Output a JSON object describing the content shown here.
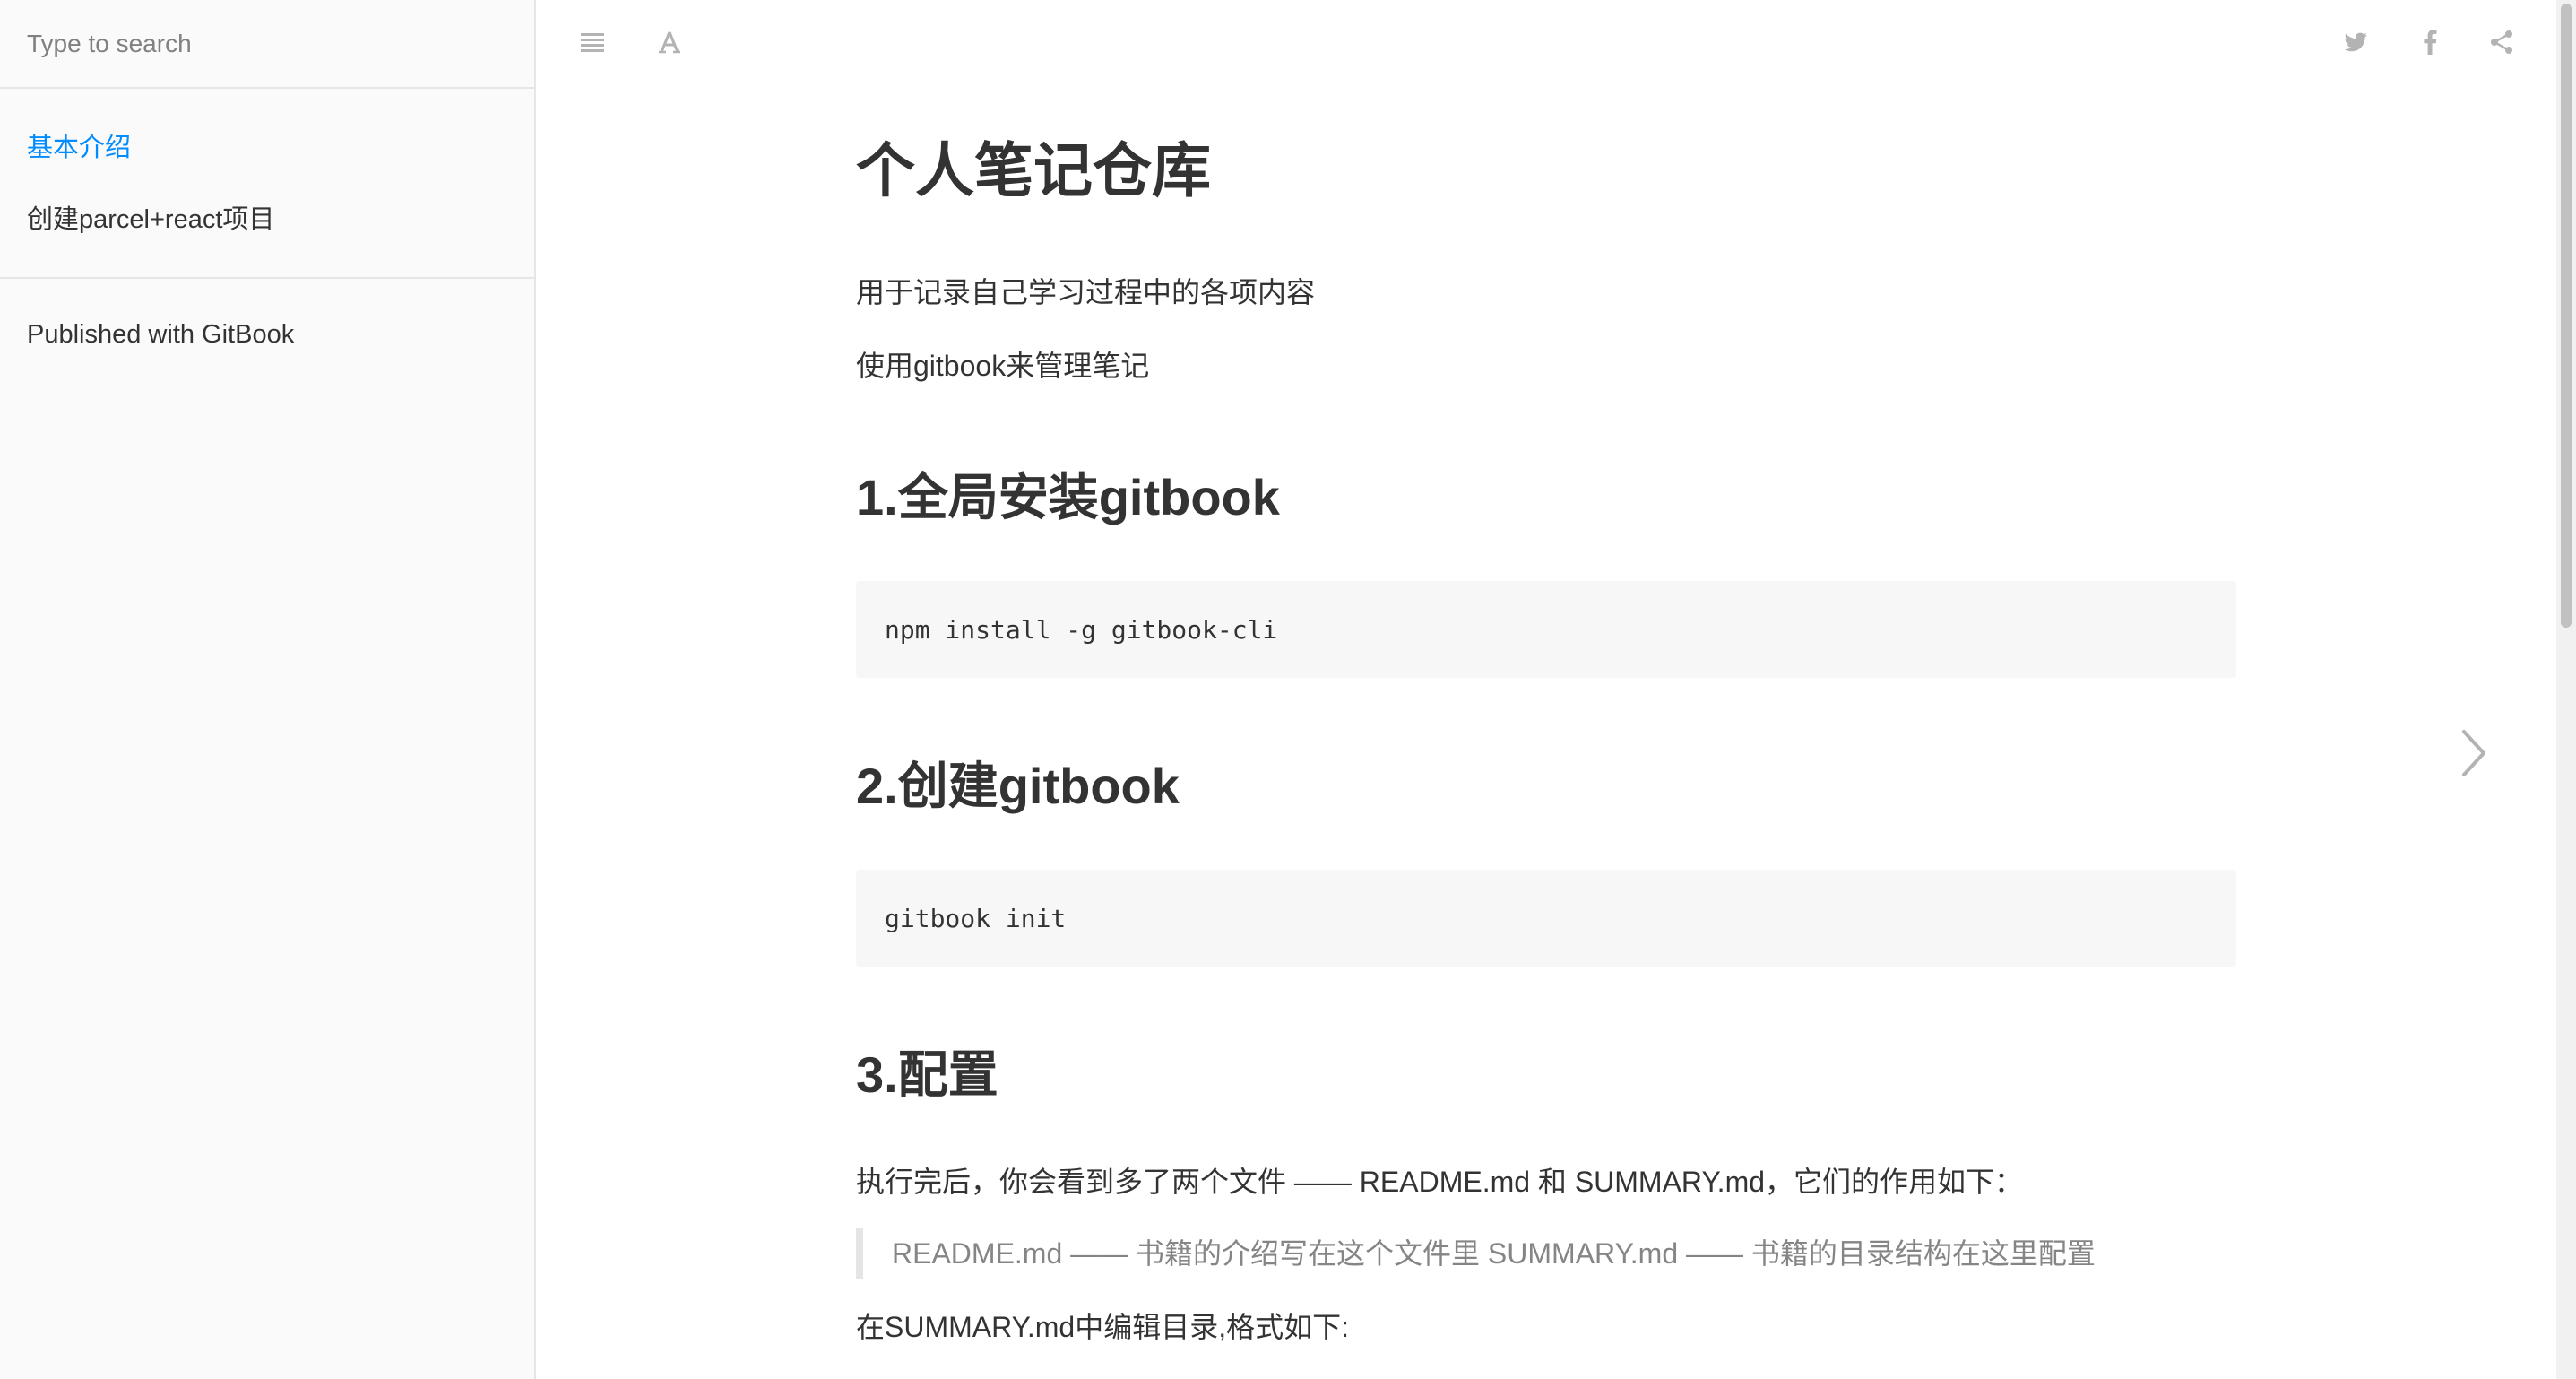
{
  "sidebar": {
    "search_placeholder": "Type to search",
    "chapters": [
      {
        "label": "基本介绍",
        "active": true
      },
      {
        "label": "创建parcel+react项目",
        "active": false
      }
    ],
    "footer_link": "Published with GitBook"
  },
  "toolbar": {
    "left_icons": [
      "menu-icon",
      "font-settings-icon"
    ],
    "right_icons": [
      "twitter-icon",
      "facebook-icon",
      "share-icon"
    ]
  },
  "content": {
    "title": "个人笔记仓库",
    "intro_1": "用于记录自己学习过程中的各项内容",
    "intro_2": "使用gitbook来管理笔记",
    "section_1": {
      "heading": "1.全局安装gitbook",
      "code": "npm install -g gitbook-cli"
    },
    "section_2": {
      "heading": "2.创建gitbook",
      "code": "gitbook init"
    },
    "section_3": {
      "heading": "3.配置",
      "paragraph": "执行完后，你会看到多了两个文件 —— README.md 和 SUMMARY.md，它们的作用如下：",
      "quote": "README.md —— 书籍的介绍写在这个文件里 SUMMARY.md —— 书籍的目录结构在这里配置",
      "paragraph_2": "在SUMMARY.md中编辑目录,格式如下:"
    }
  },
  "navigation": {
    "next_icon": "chevron-right-icon"
  },
  "colors": {
    "sidebar_bg": "#fafafa",
    "active_link": "#008cff",
    "text": "#333333",
    "code_bg": "#f7f7f7",
    "quote_text": "#858585",
    "toolbar_icon": "#b3b3b3"
  }
}
